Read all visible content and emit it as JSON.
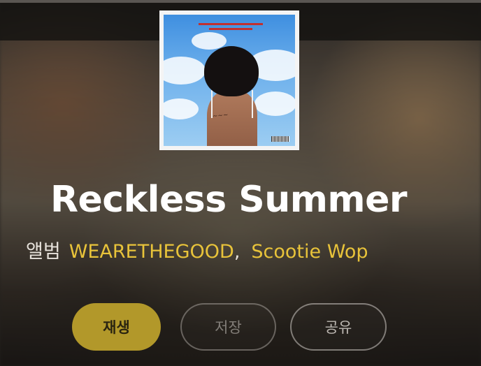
{
  "album": {
    "title": "Reckless Summer",
    "type_label": "앨범",
    "artists": [
      "WEARETHEGOOD",
      "Scootie Wop"
    ],
    "separator": ","
  },
  "actions": {
    "play_label": "재생",
    "save_label": "저장",
    "share_label": "공유"
  },
  "colors": {
    "accent": "#e8c33a",
    "play_button": "#b2982a"
  },
  "cover_art": {
    "icon": "album-cover-image"
  }
}
